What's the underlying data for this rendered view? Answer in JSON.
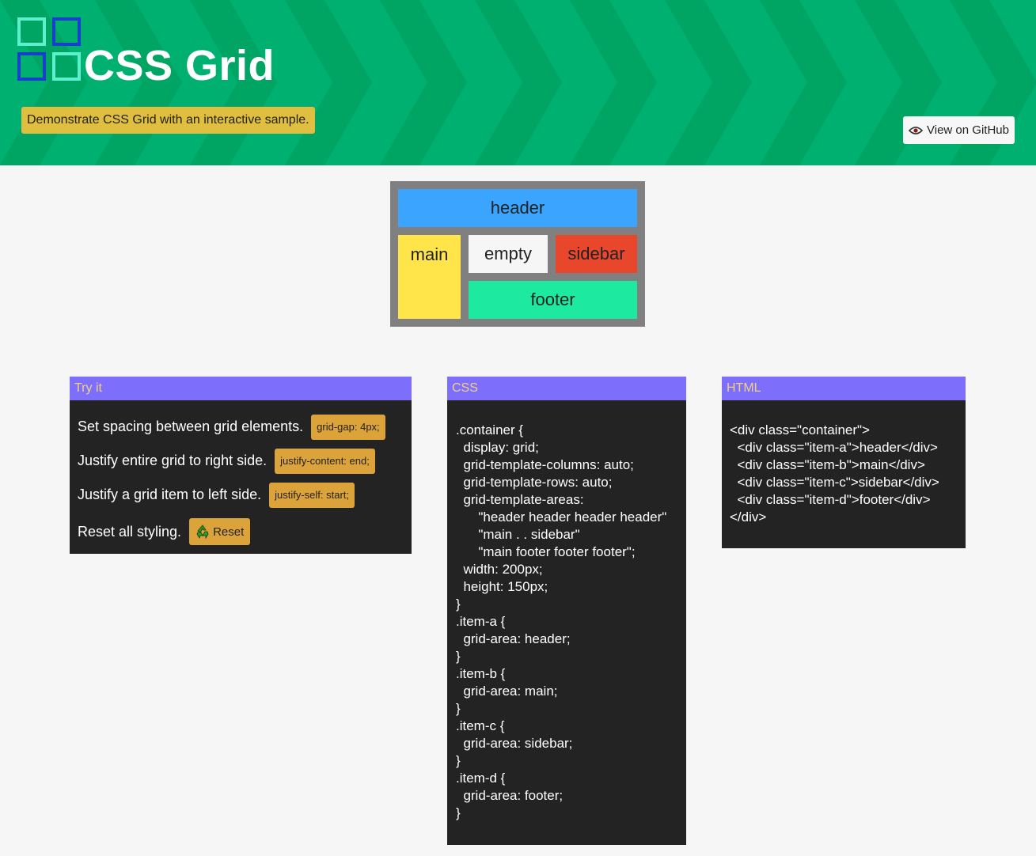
{
  "header": {
    "title": "CSS Grid",
    "tagline": "Demonstrate CSS Grid with an interactive sample.",
    "github_label": "View on GitHub",
    "logo_icon": "grid-logo-icon",
    "github_icon": "eye-icon"
  },
  "colors": {
    "banner_green": "#00b070",
    "tagline_bg": "#e0be3f",
    "panel_head": "#7d6ffb",
    "panel_head_text": "#f1d27a",
    "chip_bg": "#dca33a",
    "header_cell": "#3aa4ff",
    "main_cell": "#ffe54a",
    "sidebar_cell": "#e8472c",
    "footer_cell": "#1de9a0"
  },
  "demo": {
    "header": "header",
    "main": "main",
    "empty": "empty",
    "sidebar": "sidebar",
    "footer": "footer"
  },
  "try_it": {
    "title": "Try it",
    "rows": [
      {
        "text": "Set spacing between grid elements.",
        "button": "grid-gap: 4px;"
      },
      {
        "text": "Justify entire grid to right side.",
        "button": "justify-content: end;"
      },
      {
        "text": "Justify a grid item to left side.",
        "button": "justify-self: start;"
      },
      {
        "text": "Reset all styling.",
        "button": "Reset",
        "icon": "recycle-icon"
      }
    ]
  },
  "css_panel": {
    "title": "CSS",
    "code": ".container {\n  display: grid;\n  grid-template-columns: auto;\n  grid-template-rows: auto;\n  grid-template-areas:\n      \"header header header header\"\n      \"main . . sidebar\"\n      \"main footer footer footer\";\n  width: 200px;\n  height: 150px;\n}\n.item-a {\n  grid-area: header;\n}\n.item-b {\n  grid-area: main;\n}\n.item-c {\n  grid-area: sidebar;\n}\n.item-d {\n  grid-area: footer;\n}"
  },
  "html_panel": {
    "title": "HTML",
    "code": "<div class=\"container\">\n  <div class=\"item-a\">header</div>\n  <div class=\"item-b\">main</div>\n  <div class=\"item-c\">sidebar</div>\n  <div class=\"item-d\">footer</div>\n</div>"
  }
}
